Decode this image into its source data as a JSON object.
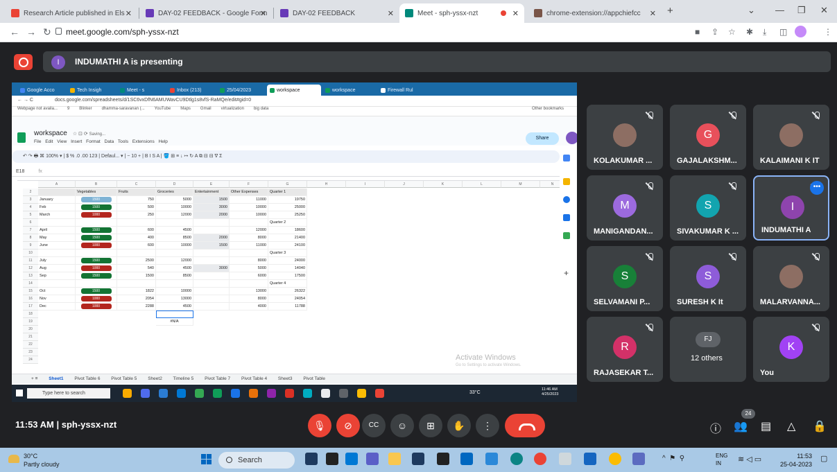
{
  "browser": {
    "tabs": [
      {
        "label": "Research Article published in Els",
        "icon_color": "#ea4335"
      },
      {
        "label": "DAY-02 FEEDBACK - Google Form",
        "icon_color": "#673ab7"
      },
      {
        "label": "DAY-02 FEEDBACK",
        "icon_color": "#673ab7"
      },
      {
        "label": "Meet - sph-yssx-nzt",
        "icon_color": "#00897b"
      },
      {
        "label": "chrome-extension://appchiefcc",
        "icon_color": "#795548"
      }
    ],
    "new_tab": "+",
    "url": "meet.google.com/sph-yssx-nzt"
  },
  "meet": {
    "presenting_initial": "I",
    "presenting_text": "INDUMATHI A is presenting",
    "meeting_info": "11:53 AM | sph-yssx-nzt",
    "participant_count": "24",
    "participants": [
      {
        "name": "KOLAKUMAR ...",
        "initial": "",
        "color": "#3c4043",
        "photo": true
      },
      {
        "name": "GAJALAKSHM...",
        "initial": "G",
        "color": "#e8505b"
      },
      {
        "name": "KALAIMANI K IT",
        "initial": "",
        "color": "#3c4043",
        "photo": true
      },
      {
        "name": "MANIGANDAN...",
        "initial": "M",
        "color": "#9c6ade"
      },
      {
        "name": "SIVAKUMAR K ...",
        "initial": "S",
        "color": "#12a4af"
      },
      {
        "name": "INDUMATHI A",
        "initial": "I",
        "color": "#8e44ad"
      },
      {
        "name": "SELVAMANI P...",
        "initial": "S",
        "color": "#188038"
      },
      {
        "name": "SURESH K It",
        "initial": "S",
        "color": "#8e5cd9"
      },
      {
        "name": "MALARVANNA...",
        "initial": "",
        "color": "#3c4043",
        "photo": true
      },
      {
        "name": "RAJASEKAR T...",
        "initial": "R",
        "color": "#d33168"
      },
      {
        "name": "12 others",
        "initial": "FJ",
        "color": "#5f6368"
      },
      {
        "name": "You",
        "initial": "K",
        "color": "#a142f4"
      }
    ]
  },
  "shared": {
    "inner_tabs": [
      "Google Acco",
      "Tech Insigh",
      "Meet - s",
      "Inbox (213)",
      "25/04/2023",
      "workspace",
      "workspace",
      "Firewall Rul"
    ],
    "inner_url": "docs.google.com/spreadsheets/d/1SC6vxDfN6AMUWavCU9Dtlg1s8vfS-RaMQe/edit#gid=0",
    "bookmarks": [
      "Webpage not availa...",
      "9",
      "Blinker",
      "dhamma-saravanan (...",
      "YouTube",
      "Maps",
      "Gmail",
      "virtualization",
      "big data",
      "Other bookmarks"
    ],
    "doc_title": "workspace",
    "saving": "Saving...",
    "menu": "File Edit View Insert Format Data Tools Extensions Help",
    "share": "Share",
    "toolbar": "↶ ↷ 🖶 ⌘ 100% ▾ | $ % .0 .00 123 | Defaul... ▾ | − 10 + | B I S A | 🪣 ⊞ ≡ ↓ ↦ ↻ A ⧉ ⊟ ⊟ ∇ Σ",
    "formula_ref": "E18",
    "formula": "fx",
    "col_heads": [
      "A",
      "B",
      "C",
      "D",
      "E",
      "F",
      "G",
      "H",
      "I",
      "J",
      "K",
      "L",
      "M",
      "N"
    ],
    "header_row": [
      "",
      "Vegetables",
      "Fruits",
      "Groceries",
      "Entertainment",
      "Other Expenses",
      "Quarter 1"
    ],
    "rows": [
      {
        "n": "3",
        "cells": [
          "January",
          "1500",
          "750",
          "5000",
          "1500",
          "11000",
          "19750"
        ],
        "veg": "blue",
        "ent": true
      },
      {
        "n": "4",
        "cells": [
          "Feb",
          "1500",
          "500",
          "10000",
          "3000",
          "10000",
          "25000"
        ],
        "veg": "green",
        "ent": true
      },
      {
        "n": "5",
        "cells": [
          "March",
          "1000",
          "250",
          "12000",
          "2000",
          "10000",
          "25250"
        ],
        "veg": "red",
        "ent": true
      },
      {
        "n": "6",
        "cells": [
          "",
          "",
          "",
          "",
          "",
          "",
          "Quarter 2"
        ],
        "veg": "",
        "ent": false
      },
      {
        "n": "7",
        "cells": [
          "April",
          "1500",
          "600",
          "4500",
          "",
          "12000",
          "18600"
        ],
        "veg": "green",
        "ent": false
      },
      {
        "n": "8",
        "cells": [
          "May",
          "1500",
          "400",
          "8500",
          "2000",
          "8000",
          "21400"
        ],
        "veg": "green",
        "ent": true
      },
      {
        "n": "9",
        "cells": [
          "June",
          "1000",
          "600",
          "10000",
          "1500",
          "11000",
          "24100"
        ],
        "veg": "red",
        "ent": true
      },
      {
        "n": "10",
        "cells": [
          "",
          "",
          "",
          "",
          "",
          "",
          "Quarter 3"
        ],
        "veg": "",
        "ent": false
      },
      {
        "n": "11",
        "cells": [
          "July",
          "1500",
          "2500",
          "12000",
          "",
          "8000",
          "24000"
        ],
        "veg": "green",
        "ent": false
      },
      {
        "n": "12",
        "cells": [
          "Aug",
          "1000",
          "540",
          "4500",
          "3000",
          "5000",
          "14040"
        ],
        "veg": "red",
        "ent": true
      },
      {
        "n": "13",
        "cells": [
          "Sep",
          "1500",
          "1500",
          "8500",
          "",
          "6000",
          "17500"
        ],
        "veg": "green",
        "ent": false
      },
      {
        "n": "14",
        "cells": [
          "",
          "",
          "",
          "",
          "",
          "",
          "Quarter 4"
        ],
        "veg": "",
        "ent": false
      },
      {
        "n": "15",
        "cells": [
          "Oct",
          "1500",
          "1822",
          "10000",
          "",
          "13000",
          "26322"
        ],
        "veg": "green",
        "ent": false
      },
      {
        "n": "16",
        "cells": [
          "Nov",
          "1000",
          "2054",
          "13000",
          "",
          "8000",
          "24054"
        ],
        "veg": "red",
        "ent": false
      },
      {
        "n": "17",
        "cells": [
          "Dec",
          "1000",
          "2288",
          "4500",
          "",
          "4000",
          "11788"
        ],
        "veg": "red",
        "ent": false
      }
    ],
    "na_value": "#N/A",
    "sheet_tabs": [
      "Sheet1",
      "Pivot Table 6",
      "Pivot Table 5",
      "Sheet2",
      "Timeline 5",
      "Pivot Table 7",
      "Pivot Table 4",
      "Sheet3",
      "Pivot Table"
    ],
    "activate_title": "Activate Windows",
    "activate_sub": "Go to Settings to activate Windows.",
    "inner_search": "Type here to search",
    "inner_temp": "33°C",
    "inner_time": "11:46 AM",
    "inner_date": "4/25/2023"
  },
  "taskbar": {
    "weather_temp": "30°C",
    "weather_text": "Partly cloudy",
    "search": "Search",
    "lang": "ENG",
    "region": "IN",
    "time": "11:53",
    "date": "25-04-2023"
  }
}
